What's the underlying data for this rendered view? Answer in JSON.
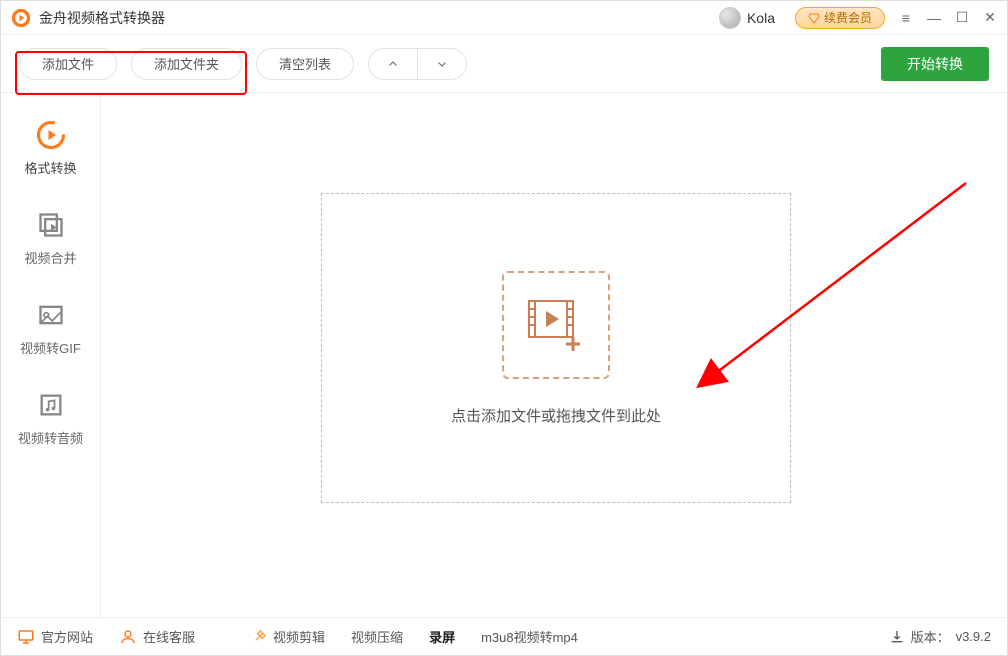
{
  "app": {
    "title": "金舟视频格式转换器"
  },
  "user": {
    "name": "Kola"
  },
  "vip": {
    "label": "续费会员"
  },
  "toolbar": {
    "add_file": "添加文件",
    "add_folder": "添加文件夹",
    "clear_list": "清空列表",
    "start": "开始转换"
  },
  "sidebar": {
    "items": [
      {
        "label": "格式转换"
      },
      {
        "label": "视频合并"
      },
      {
        "label": "视频转GIF"
      },
      {
        "label": "视频转音频"
      }
    ]
  },
  "dropzone": {
    "text": "点击添加文件或拖拽文件到此处"
  },
  "footer": {
    "official_site": "官方网站",
    "online_service": "在线客服",
    "video_edit": "视频剪辑",
    "video_compress": "视频压缩",
    "screen_record": "录屏",
    "m3u8": "m3u8视频转mp4",
    "version_label": "版本：",
    "version_value": "v3.9.2"
  }
}
